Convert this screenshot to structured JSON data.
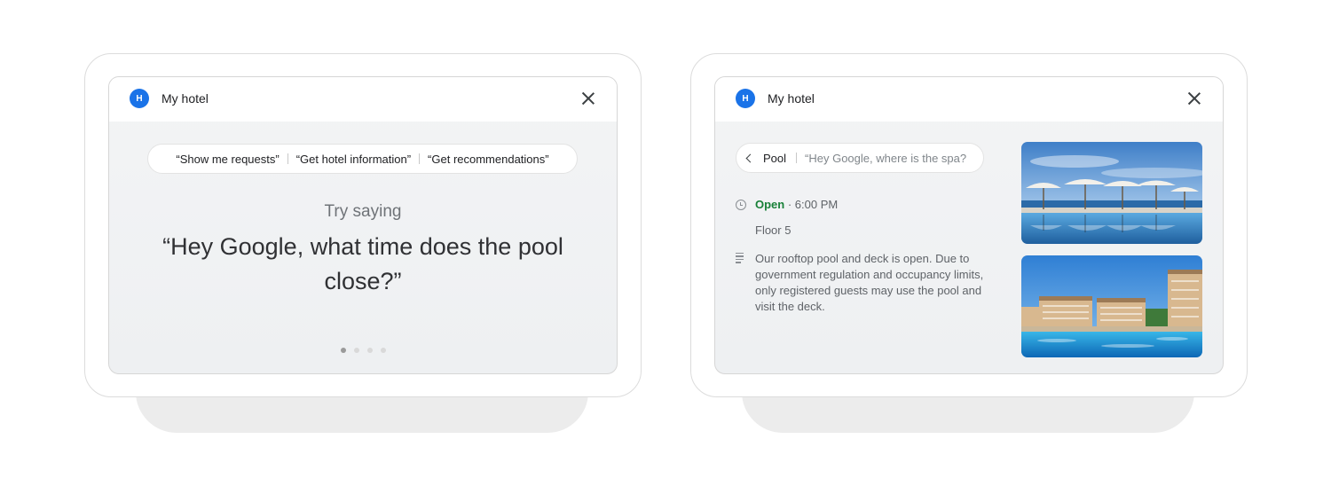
{
  "left_device": {
    "header": {
      "avatar_letter": "H",
      "title": "My hotel"
    },
    "suggestions": [
      "“Show me requests”",
      "“Get hotel information”",
      "“Get recommendations”"
    ],
    "try_label": "Try saying",
    "quote": "“Hey Google, what time does the pool close?”",
    "pagination": {
      "total": 4,
      "active": 1
    }
  },
  "right_device": {
    "header": {
      "avatar_letter": "H",
      "title": "My hotel"
    },
    "chip": {
      "back_label": "Pool",
      "hint": "“Hey Google, where is the spa?"
    },
    "hours": {
      "status": "Open",
      "rest": " · 6:00 PM"
    },
    "floor": "Floor 5",
    "description": "Our rooftop pool and deck is open. Due to government regulation and occupancy limits, only registered guests may use the pool and visit the deck.",
    "images": [
      {
        "name": "pool-umbrellas-photo"
      },
      {
        "name": "resort-pool-photo"
      }
    ]
  },
  "colors": {
    "accent": "#1a73e8",
    "open_green": "#188038"
  }
}
